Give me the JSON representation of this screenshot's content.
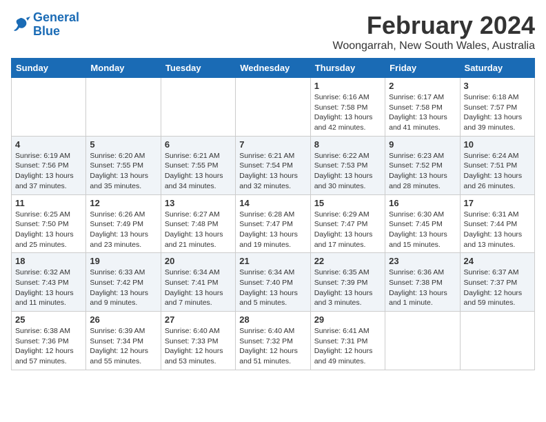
{
  "logo": {
    "line1": "General",
    "line2": "Blue"
  },
  "title": "February 2024",
  "subtitle": "Woongarrah, New South Wales, Australia",
  "days_of_week": [
    "Sunday",
    "Monday",
    "Tuesday",
    "Wednesday",
    "Thursday",
    "Friday",
    "Saturday"
  ],
  "weeks": [
    {
      "shaded": false,
      "days": [
        {
          "number": "",
          "info": ""
        },
        {
          "number": "",
          "info": ""
        },
        {
          "number": "",
          "info": ""
        },
        {
          "number": "",
          "info": ""
        },
        {
          "number": "1",
          "info": "Sunrise: 6:16 AM\nSunset: 7:58 PM\nDaylight: 13 hours\nand 42 minutes."
        },
        {
          "number": "2",
          "info": "Sunrise: 6:17 AM\nSunset: 7:58 PM\nDaylight: 13 hours\nand 41 minutes."
        },
        {
          "number": "3",
          "info": "Sunrise: 6:18 AM\nSunset: 7:57 PM\nDaylight: 13 hours\nand 39 minutes."
        }
      ]
    },
    {
      "shaded": true,
      "days": [
        {
          "number": "4",
          "info": "Sunrise: 6:19 AM\nSunset: 7:56 PM\nDaylight: 13 hours\nand 37 minutes."
        },
        {
          "number": "5",
          "info": "Sunrise: 6:20 AM\nSunset: 7:55 PM\nDaylight: 13 hours\nand 35 minutes."
        },
        {
          "number": "6",
          "info": "Sunrise: 6:21 AM\nSunset: 7:55 PM\nDaylight: 13 hours\nand 34 minutes."
        },
        {
          "number": "7",
          "info": "Sunrise: 6:21 AM\nSunset: 7:54 PM\nDaylight: 13 hours\nand 32 minutes."
        },
        {
          "number": "8",
          "info": "Sunrise: 6:22 AM\nSunset: 7:53 PM\nDaylight: 13 hours\nand 30 minutes."
        },
        {
          "number": "9",
          "info": "Sunrise: 6:23 AM\nSunset: 7:52 PM\nDaylight: 13 hours\nand 28 minutes."
        },
        {
          "number": "10",
          "info": "Sunrise: 6:24 AM\nSunset: 7:51 PM\nDaylight: 13 hours\nand 26 minutes."
        }
      ]
    },
    {
      "shaded": false,
      "days": [
        {
          "number": "11",
          "info": "Sunrise: 6:25 AM\nSunset: 7:50 PM\nDaylight: 13 hours\nand 25 minutes."
        },
        {
          "number": "12",
          "info": "Sunrise: 6:26 AM\nSunset: 7:49 PM\nDaylight: 13 hours\nand 23 minutes."
        },
        {
          "number": "13",
          "info": "Sunrise: 6:27 AM\nSunset: 7:48 PM\nDaylight: 13 hours\nand 21 minutes."
        },
        {
          "number": "14",
          "info": "Sunrise: 6:28 AM\nSunset: 7:47 PM\nDaylight: 13 hours\nand 19 minutes."
        },
        {
          "number": "15",
          "info": "Sunrise: 6:29 AM\nSunset: 7:47 PM\nDaylight: 13 hours\nand 17 minutes."
        },
        {
          "number": "16",
          "info": "Sunrise: 6:30 AM\nSunset: 7:45 PM\nDaylight: 13 hours\nand 15 minutes."
        },
        {
          "number": "17",
          "info": "Sunrise: 6:31 AM\nSunset: 7:44 PM\nDaylight: 13 hours\nand 13 minutes."
        }
      ]
    },
    {
      "shaded": true,
      "days": [
        {
          "number": "18",
          "info": "Sunrise: 6:32 AM\nSunset: 7:43 PM\nDaylight: 13 hours\nand 11 minutes."
        },
        {
          "number": "19",
          "info": "Sunrise: 6:33 AM\nSunset: 7:42 PM\nDaylight: 13 hours\nand 9 minutes."
        },
        {
          "number": "20",
          "info": "Sunrise: 6:34 AM\nSunset: 7:41 PM\nDaylight: 13 hours\nand 7 minutes."
        },
        {
          "number": "21",
          "info": "Sunrise: 6:34 AM\nSunset: 7:40 PM\nDaylight: 13 hours\nand 5 minutes."
        },
        {
          "number": "22",
          "info": "Sunrise: 6:35 AM\nSunset: 7:39 PM\nDaylight: 13 hours\nand 3 minutes."
        },
        {
          "number": "23",
          "info": "Sunrise: 6:36 AM\nSunset: 7:38 PM\nDaylight: 13 hours\nand 1 minute."
        },
        {
          "number": "24",
          "info": "Sunrise: 6:37 AM\nSunset: 7:37 PM\nDaylight: 12 hours\nand 59 minutes."
        }
      ]
    },
    {
      "shaded": false,
      "days": [
        {
          "number": "25",
          "info": "Sunrise: 6:38 AM\nSunset: 7:36 PM\nDaylight: 12 hours\nand 57 minutes."
        },
        {
          "number": "26",
          "info": "Sunrise: 6:39 AM\nSunset: 7:34 PM\nDaylight: 12 hours\nand 55 minutes."
        },
        {
          "number": "27",
          "info": "Sunrise: 6:40 AM\nSunset: 7:33 PM\nDaylight: 12 hours\nand 53 minutes."
        },
        {
          "number": "28",
          "info": "Sunrise: 6:40 AM\nSunset: 7:32 PM\nDaylight: 12 hours\nand 51 minutes."
        },
        {
          "number": "29",
          "info": "Sunrise: 6:41 AM\nSunset: 7:31 PM\nDaylight: 12 hours\nand 49 minutes."
        },
        {
          "number": "",
          "info": ""
        },
        {
          "number": "",
          "info": ""
        }
      ]
    }
  ]
}
